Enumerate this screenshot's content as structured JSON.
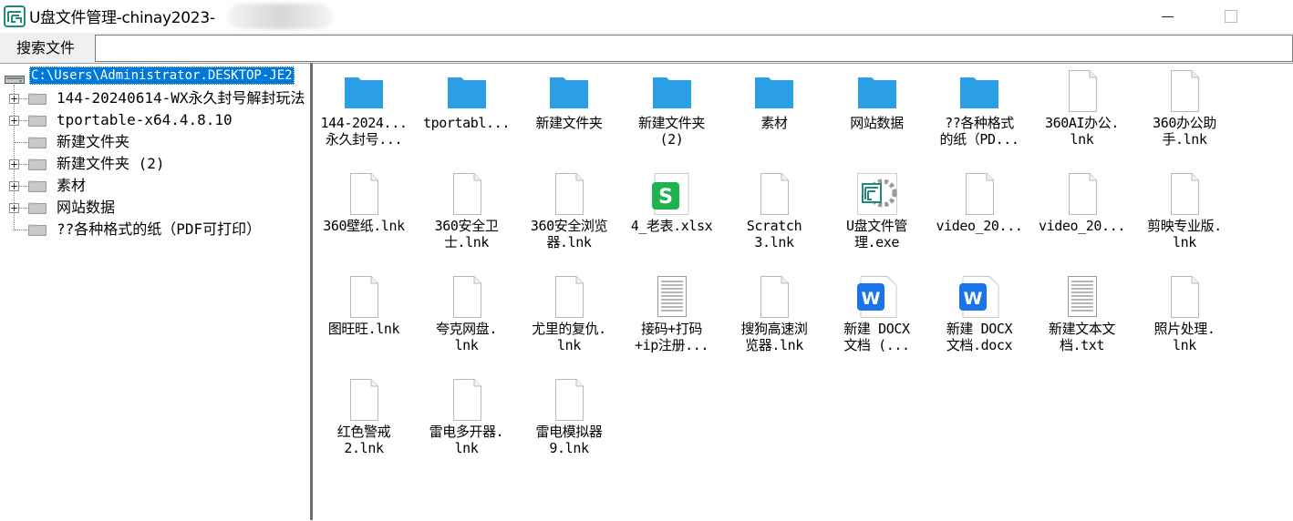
{
  "window": {
    "title": "U盘文件管理-chinay2023-"
  },
  "toolbar": {
    "search_button": "搜索文件",
    "search_value": ""
  },
  "tree": {
    "root_label": "C:\\Users\\Administrator.DESKTOP-JE2",
    "items": [
      {
        "label": "144-20240614-WX永久封号解封玩法",
        "expandable": true
      },
      {
        "label": "tportable-x64.4.8.10",
        "expandable": true
      },
      {
        "label": "新建文件夹",
        "expandable": false
      },
      {
        "label": "新建文件夹 (2)",
        "expandable": true
      },
      {
        "label": "素材",
        "expandable": true
      },
      {
        "label": "网站数据",
        "expandable": true
      },
      {
        "label": "??各种格式的纸（PDF可打印）",
        "expandable": false
      }
    ]
  },
  "files": [
    {
      "label": "144-2024...\n永久封号...",
      "icon": "folder-icon"
    },
    {
      "label": "tportabl...",
      "icon": "folder-icon"
    },
    {
      "label": "新建文件夹",
      "icon": "folder-icon"
    },
    {
      "label": "新建文件夹\n(2)",
      "icon": "folder-icon"
    },
    {
      "label": "素材",
      "icon": "folder-icon"
    },
    {
      "label": "网站数据",
      "icon": "folder-icon"
    },
    {
      "label": "??各种格式\n的纸（PD...",
      "icon": "folder-icon"
    },
    {
      "label": "360AI办公.\nlnk",
      "icon": "file-icon"
    },
    {
      "label": "360办公助\n手.lnk",
      "icon": "file-icon"
    },
    {
      "label": "360壁纸.lnk",
      "icon": "file-icon"
    },
    {
      "label": "360安全卫\n士.lnk",
      "icon": "file-icon"
    },
    {
      "label": "360安全浏览\n器.lnk",
      "icon": "file-icon"
    },
    {
      "label": "4_老表.xlsx",
      "icon": "spreadsheet-icon"
    },
    {
      "label": "Scratch\n3.lnk",
      "icon": "file-icon"
    },
    {
      "label": "U盘文件管\n理.exe",
      "icon": "app-exe-icon"
    },
    {
      "label": "video_20...",
      "icon": "file-icon"
    },
    {
      "label": "video_20...",
      "icon": "file-icon"
    },
    {
      "label": "剪映专业版.\nlnk",
      "icon": "file-icon"
    },
    {
      "label": "图旺旺.lnk",
      "icon": "file-icon"
    },
    {
      "label": "夸克网盘.\nlnk",
      "icon": "file-icon"
    },
    {
      "label": "尤里的复仇.\nlnk",
      "icon": "file-icon"
    },
    {
      "label": "接码+打码\n+ip注册...",
      "icon": "text-file-icon"
    },
    {
      "label": "搜狗高速浏\n览器.lnk",
      "icon": "file-icon"
    },
    {
      "label": "新建 DOCX\n文档 (...",
      "icon": "word-doc-icon"
    },
    {
      "label": "新建 DOCX\n文档.docx",
      "icon": "word-doc-icon"
    },
    {
      "label": "新建文本文\n档.txt",
      "icon": "text-file-icon"
    },
    {
      "label": "照片处理.\nlnk",
      "icon": "file-icon"
    },
    {
      "label": "红色警戒\n2.lnk",
      "icon": "file-icon"
    },
    {
      "label": "雷电多开器.\nlnk",
      "icon": "file-icon"
    },
    {
      "label": "雷电模拟器\n9.lnk",
      "icon": "file-icon"
    }
  ],
  "colors": {
    "selection": "#0078d7",
    "folder": "#2a9ee6",
    "spreadsheet": "#1fb24f",
    "word": "#1a73e8"
  }
}
